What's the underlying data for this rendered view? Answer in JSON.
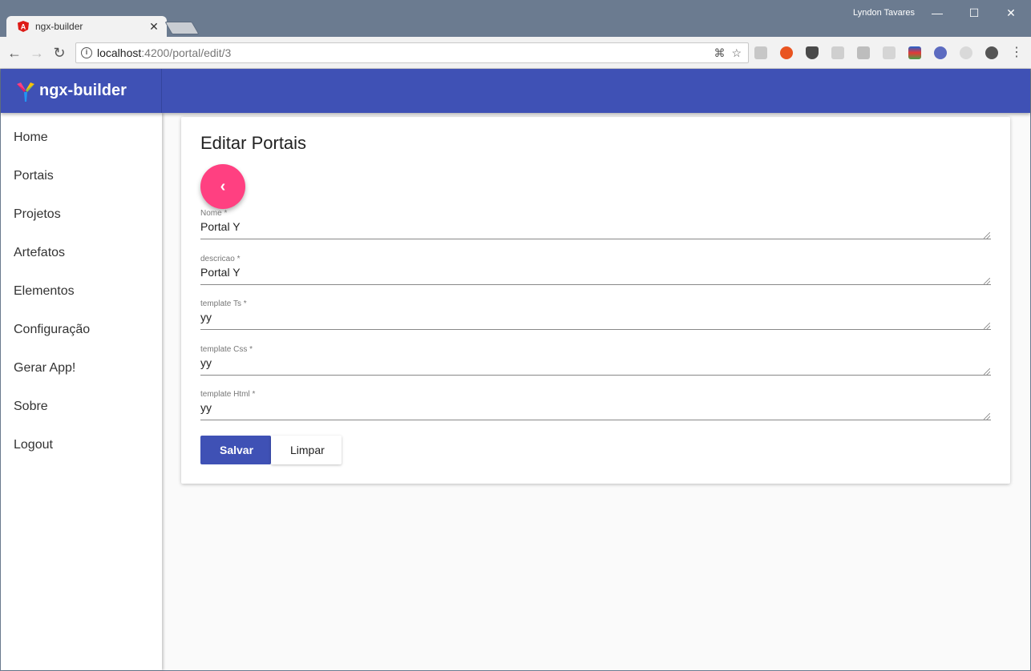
{
  "browser": {
    "tab_title": "ngx-builder",
    "tab_close": "✕",
    "user_name": "Lyndon Tavares",
    "url_host": "localhost",
    "url_path": ":4200/portal/edit/3",
    "window_controls": {
      "minimize": "—",
      "maximize": "☐",
      "close": "✕"
    },
    "nav": {
      "back": "←",
      "forward": "→",
      "reload": "↻"
    },
    "extensions": [
      "translate-icon",
      "star-icon",
      "pdf-icon",
      "ubuntu-icon",
      "pocket-icon",
      "puzzle-icon",
      "screenshot-icon",
      "doc-icon",
      "tool-icon",
      "r-icon",
      "sync-icon",
      "evernote-icon",
      "menu-icon"
    ]
  },
  "app": {
    "brand": "ngx-builder",
    "primary_color": "#3f51b5",
    "accent_color": "#ff4081"
  },
  "sidebar": {
    "items": [
      {
        "label": "Home"
      },
      {
        "label": "Portais"
      },
      {
        "label": "Projetos"
      },
      {
        "label": "Artefatos"
      },
      {
        "label": "Elementos"
      },
      {
        "label": "Configuração"
      },
      {
        "label": "Gerar App!"
      },
      {
        "label": "Sobre"
      },
      {
        "label": "Logout"
      }
    ]
  },
  "form": {
    "title": "Editar Portais",
    "back_icon": "‹",
    "fields": [
      {
        "label": "Nome *",
        "value": "Portal Y"
      },
      {
        "label": "descricao *",
        "value": "Portal Y"
      },
      {
        "label": "template Ts *",
        "value": "yy"
      },
      {
        "label": "template Css *",
        "value": "yy"
      },
      {
        "label": "template Html *",
        "value": "yy"
      }
    ],
    "save_label": "Salvar",
    "clear_label": "Limpar"
  }
}
